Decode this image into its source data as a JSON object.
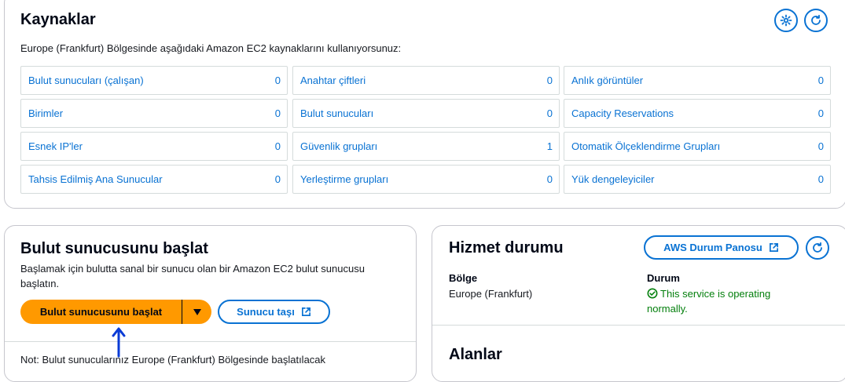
{
  "resources": {
    "title": "Kaynaklar",
    "description": "Europe (Frankfurt) Bölgesinde aşağıdaki Amazon EC2 kaynaklarını kullanıyorsunuz:",
    "items": [
      {
        "label": "Bulut sunucuları (çalışan)",
        "count": "0"
      },
      {
        "label": "Anahtar çiftleri",
        "count": "0"
      },
      {
        "label": "Anlık görüntüler",
        "count": "0"
      },
      {
        "label": "Birimler",
        "count": "0"
      },
      {
        "label": "Bulut sunucuları",
        "count": "0"
      },
      {
        "label": "Capacity Reservations",
        "count": "0"
      },
      {
        "label": "Esnek IP'ler",
        "count": "0"
      },
      {
        "label": "Güvenlik grupları",
        "count": "1"
      },
      {
        "label": "Otomatik Ölçeklendirme Grupları",
        "count": "0"
      },
      {
        "label": "Tahsis Edilmiş Ana Sunucular",
        "count": "0"
      },
      {
        "label": "Yerleştirme grupları",
        "count": "0"
      },
      {
        "label": "Yük dengeleyiciler",
        "count": "0"
      }
    ],
    "settings_icon": "gear-icon",
    "refresh_icon": "refresh-icon"
  },
  "launch": {
    "title": "Bulut sunucusunu başlat",
    "description": "Başlamak için bulutta sanal bir sunucu olan bir Amazon EC2 bulut sunucusu başlatın.",
    "launch_button": "Bulut sunucusunu başlat",
    "migrate_button": "Sunucu taşı",
    "note": "Not: Bulut sunucularınız Europe (Frankfurt) Bölgesinde başlatılacak"
  },
  "health": {
    "title": "Hizmet durumu",
    "dashboard_button": "AWS Durum Panosu",
    "region_label": "Bölge",
    "region_value": "Europe (Frankfurt)",
    "status_label": "Durum",
    "status_value": "This service is operating normally.",
    "zones_title": "Alanlar"
  },
  "colors": {
    "link": "#0972d3",
    "primary": "#ff9900",
    "success": "#037f0c"
  }
}
